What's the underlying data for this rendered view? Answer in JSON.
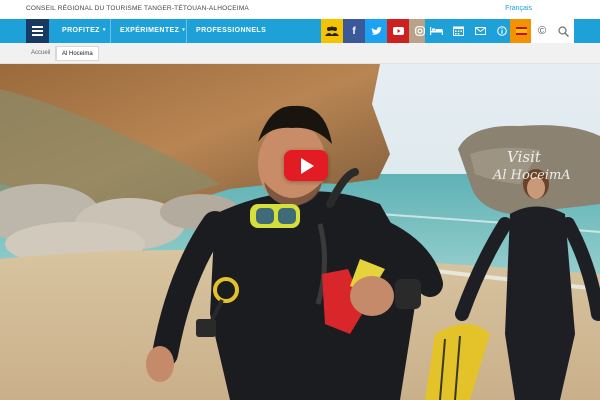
{
  "topbar": {
    "org_name": "CONSEIL RÉGIONAL DU TOURISME TANGER-TÉTOUAN-ALHOCEIMA",
    "language": "Français"
  },
  "nav": {
    "menu_icon": "hamburger-icon",
    "items": [
      {
        "label": "PROFITEZ",
        "has_dropdown": true
      },
      {
        "label": "EXPÉRIMENTEZ",
        "has_dropdown": true
      },
      {
        "label": "PROFESSIONNELS",
        "has_dropdown": false
      }
    ],
    "icon_buttons": [
      {
        "name": "people-icon",
        "color": "#f5c400"
      },
      {
        "name": "facebook-icon",
        "color": "#3b5998"
      },
      {
        "name": "twitter-icon",
        "color": "#1da1f2"
      },
      {
        "name": "youtube-icon",
        "color": "#cd201f"
      },
      {
        "name": "instagram-icon",
        "color": "#b8a28a"
      },
      {
        "name": "bed-icon",
        "color": "#1ea1d9"
      },
      {
        "name": "calendar-icon",
        "color": "#1ea1d9"
      },
      {
        "name": "mail-icon",
        "color": "#1ea1d9"
      },
      {
        "name": "info-icon",
        "color": "#1ea1d9"
      },
      {
        "name": "flag-icon",
        "color": "#f39200"
      },
      {
        "name": "copyright-icon",
        "color": "#ffffff"
      },
      {
        "name": "search-icon",
        "color": "#ffffff"
      }
    ]
  },
  "breadcrumb": {
    "home": "Accueil",
    "current": "Al Hoceima"
  },
  "hero": {
    "watermark_line1": "Visit",
    "watermark_line2": "Al HoceimA",
    "play_icon": "youtube-play-icon"
  },
  "colors": {
    "nav_blue": "#1ea1d9",
    "menu_navy": "#173a63",
    "play_red": "#e31b23"
  }
}
